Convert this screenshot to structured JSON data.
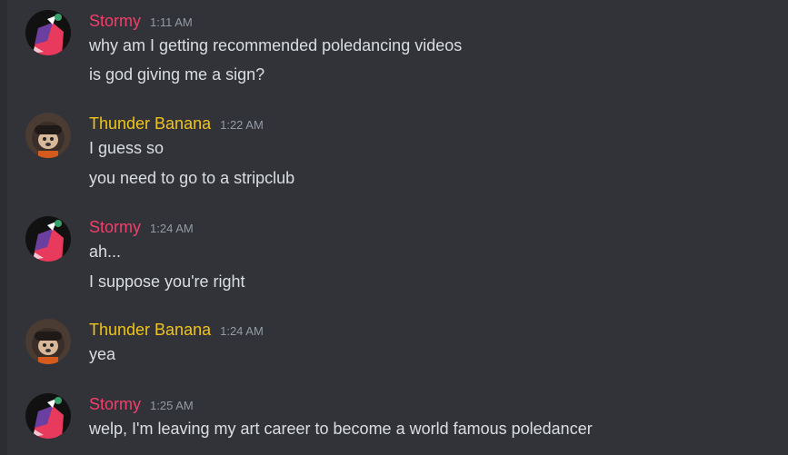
{
  "colors": {
    "background": "#313338",
    "stormy": "#f23f6c",
    "thunder_banana": "#f0c419",
    "text": "#dbdee1",
    "timestamp": "#949ba4"
  },
  "groups": [
    {
      "author": "Stormy",
      "time": "1:11 AM",
      "avatar": "stormy-avatar",
      "messages": [
        "why am I getting recommended poledancing videos",
        "is god giving me a sign?"
      ]
    },
    {
      "author": "Thunder Banana",
      "time": "1:22 AM",
      "avatar": "thunder-banana-avatar",
      "messages": [
        "I guess so",
        "you need to go to a stripclub"
      ]
    },
    {
      "author": "Stormy",
      "time": "1:24 AM",
      "avatar": "stormy-avatar",
      "messages": [
        "ah...",
        "I suppose you're right"
      ]
    },
    {
      "author": "Thunder Banana",
      "time": "1:24 AM",
      "avatar": "thunder-banana-avatar",
      "messages": [
        "yea"
      ]
    },
    {
      "author": "Stormy",
      "time": "1:25 AM",
      "avatar": "stormy-avatar",
      "messages": [
        "welp, I'm leaving my art career to become a world famous poledancer"
      ]
    }
  ]
}
